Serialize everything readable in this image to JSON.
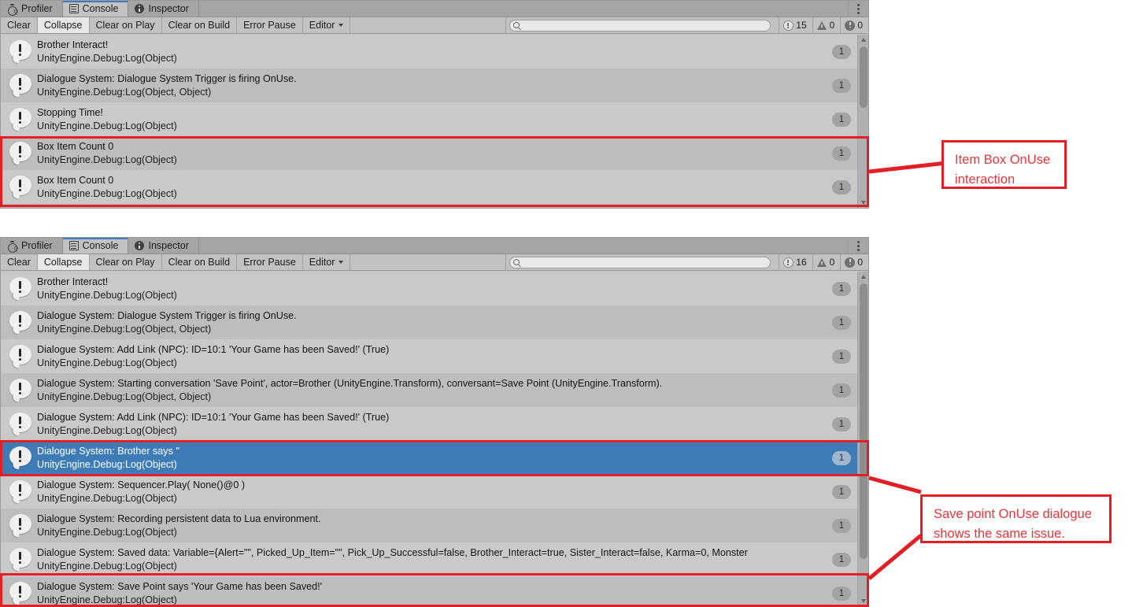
{
  "panels": [
    {
      "id": "console-panel-top",
      "tabs": [
        {
          "label": "Profiler",
          "icon": "stopwatch-icon",
          "active": false
        },
        {
          "label": "Console",
          "icon": "console-icon",
          "active": true
        },
        {
          "label": "Inspector",
          "icon": "info-icon",
          "active": false
        }
      ],
      "toolbar": {
        "clear": "Clear",
        "collapse": "Collapse",
        "clear_on_play": "Clear on Play",
        "clear_on_build": "Clear on Build",
        "error_pause": "Error Pause",
        "editor": "Editor",
        "search_value": "",
        "search_placeholder": "",
        "counters": {
          "errors": "15",
          "warnings": "0",
          "infos": "0"
        }
      },
      "rows": [
        {
          "message": "Brother Interact!",
          "stack": "UnityEngine.Debug:Log(Object)",
          "count": "1",
          "selected": false
        },
        {
          "message": "Dialogue System: Dialogue System Trigger is firing OnUse.",
          "stack": "UnityEngine.Debug:Log(Object, Object)",
          "count": "1",
          "selected": false
        },
        {
          "message": "Stopping Time!",
          "stack": "UnityEngine.Debug:Log(Object)",
          "count": "1",
          "selected": false
        },
        {
          "message": "Box Item Count 0",
          "stack": "UnityEngine.Debug:Log(Object)",
          "count": "1",
          "selected": false
        },
        {
          "message": "Box Item Count 0",
          "stack": "UnityEngine.Debug:Log(Object)",
          "count": "1",
          "selected": false
        }
      ]
    },
    {
      "id": "console-panel-bottom",
      "tabs": [
        {
          "label": "Profiler",
          "icon": "stopwatch-icon",
          "active": false
        },
        {
          "label": "Console",
          "icon": "console-icon",
          "active": true
        },
        {
          "label": "Inspector",
          "icon": "info-icon",
          "active": false
        }
      ],
      "toolbar": {
        "clear": "Clear",
        "collapse": "Collapse",
        "clear_on_play": "Clear on Play",
        "clear_on_build": "Clear on Build",
        "error_pause": "Error Pause",
        "editor": "Editor",
        "search_value": "",
        "search_placeholder": "",
        "counters": {
          "errors": "16",
          "warnings": "0",
          "infos": "0"
        }
      },
      "rows": [
        {
          "message": "Brother Interact!",
          "stack": "UnityEngine.Debug:Log(Object)",
          "count": "1",
          "selected": false
        },
        {
          "message": "Dialogue System: Dialogue System Trigger is firing OnUse.",
          "stack": "UnityEngine.Debug:Log(Object, Object)",
          "count": "1",
          "selected": false
        },
        {
          "message": "Dialogue System: Add Link (NPC): ID=10:1 'Your Game has been Saved!' (True)",
          "stack": "UnityEngine.Debug:Log(Object)",
          "count": "1",
          "selected": false
        },
        {
          "message": "Dialogue System: Starting conversation 'Save Point', actor=Brother (UnityEngine.Transform), conversant=Save Point (UnityEngine.Transform).",
          "stack": "UnityEngine.Debug:Log(Object, Object)",
          "count": "1",
          "selected": false
        },
        {
          "message": "Dialogue System: Add Link (NPC): ID=10:1 'Your Game has been Saved!' (True)",
          "stack": "UnityEngine.Debug:Log(Object)",
          "count": "1",
          "selected": false
        },
        {
          "message": "Dialogue System: Brother says ''",
          "stack": "UnityEngine.Debug:Log(Object)",
          "count": "1",
          "selected": true
        },
        {
          "message": "Dialogue System: Sequencer.Play( None()@0 )",
          "stack": "UnityEngine.Debug:Log(Object)",
          "count": "1",
          "selected": false
        },
        {
          "message": "Dialogue System: Recording persistent data to Lua environment.",
          "stack": "UnityEngine.Debug:Log(Object)",
          "count": "1",
          "selected": false
        },
        {
          "message": "Dialogue System: Saved data: Variable={Alert=\"\", Picked_Up_Item=\"\", Pick_Up_Successful=false, Brother_Interact=true, Sister_Interact=false, Karma=0, Monster",
          "stack": "UnityEngine.Debug:Log(Object)",
          "count": "1",
          "selected": false
        },
        {
          "message": "Dialogue System: Save Point says 'Your Game has been Saved!'",
          "stack": "UnityEngine.Debug:Log(Object)",
          "count": "1",
          "selected": false
        }
      ]
    }
  ],
  "annotations": [
    {
      "id": "annotation-item-box",
      "text": "Item Box OnUse\ninteraction"
    },
    {
      "id": "annotation-save-point",
      "text": "Save point OnUse dialogue\nshows the same issue."
    }
  ],
  "colors": {
    "annotation_red": "#e31e24",
    "annotation_text": "#e8353b",
    "selection_blue": "#3e7cb8",
    "panel_bg": "#c2c2c2"
  }
}
